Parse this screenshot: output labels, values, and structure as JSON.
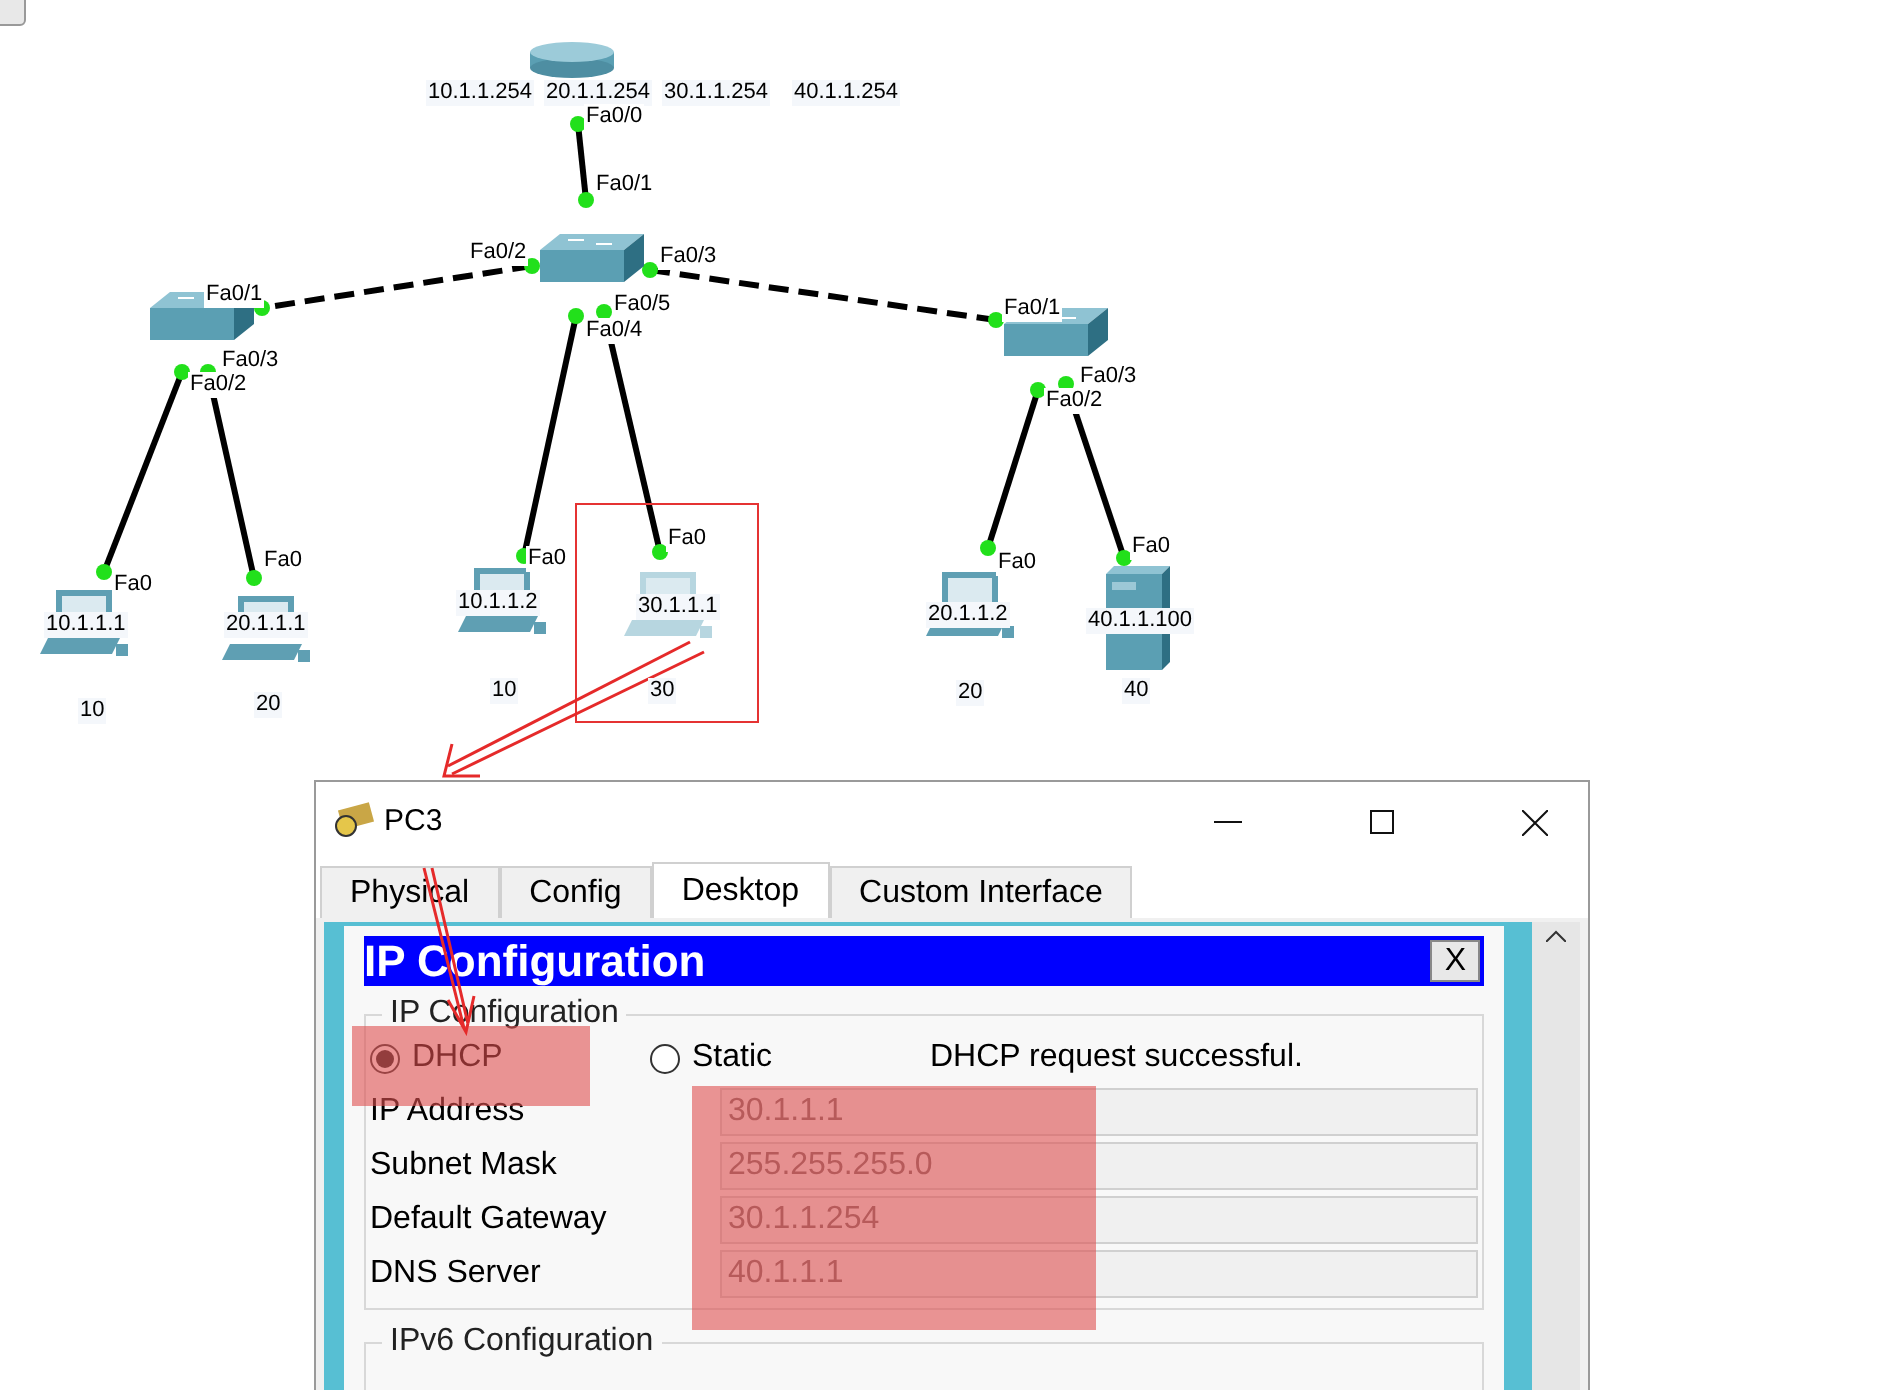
{
  "topology": {
    "router": {
      "addresses": [
        "10.1.1.254",
        "20.1.1.254",
        "30.1.1.254",
        "40.1.1.254"
      ]
    },
    "port_labels": [
      "Fa0/0",
      "Fa0/1",
      "Fa0/2",
      "Fa0/3",
      "Fa0/5",
      "Fa0/4",
      "Fa0/1",
      "Fa0/3",
      "Fa0/2",
      "Fa0/1",
      "Fa0/3",
      "Fa0/2"
    ],
    "hosts": [
      {
        "kind": "pc",
        "port": "Fa0",
        "ip": "10.1.1.1",
        "vlan": "10",
        "highlighted": false
      },
      {
        "kind": "pc",
        "port": "Fa0",
        "ip": "20.1.1.1",
        "vlan": "20",
        "highlighted": false
      },
      {
        "kind": "pc",
        "port": "Fa0",
        "ip": "10.1.1.2",
        "vlan": "10",
        "highlighted": false
      },
      {
        "kind": "pc",
        "port": "Fa0",
        "ip": "30.1.1.1",
        "vlan": "30",
        "highlighted": true
      },
      {
        "kind": "pc",
        "port": "Fa0",
        "ip": "20.1.1.2",
        "vlan": "20",
        "highlighted": false
      },
      {
        "kind": "server",
        "port": "Fa0",
        "ip": "40.1.1.100",
        "vlan": "40",
        "highlighted": false
      }
    ]
  },
  "dialog": {
    "title": "PC3",
    "tabs": [
      {
        "label": "Physical",
        "selected": false
      },
      {
        "label": "Config",
        "selected": false
      },
      {
        "label": "Desktop",
        "selected": true
      },
      {
        "label": "Custom Interface",
        "selected": false
      }
    ],
    "panel": {
      "title": "IP Configuration",
      "close": "X",
      "ipv4": {
        "legend": "IP Configuration",
        "modes": [
          {
            "label": "DHCP",
            "selected": true
          },
          {
            "label": "Static",
            "selected": false
          }
        ],
        "status": "DHCP request successful.",
        "fields": [
          {
            "label": "IP Address",
            "value": "30.1.1.1",
            "disabled": true
          },
          {
            "label": "Subnet Mask",
            "value": "255.255.255.0",
            "disabled": true
          },
          {
            "label": "Default Gateway",
            "value": "30.1.1.254",
            "disabled": true
          },
          {
            "label": "DNS Server",
            "value": "40.1.1.1",
            "disabled": true
          }
        ]
      },
      "ipv6": {
        "legend": "IPv6 Configuration"
      }
    }
  }
}
